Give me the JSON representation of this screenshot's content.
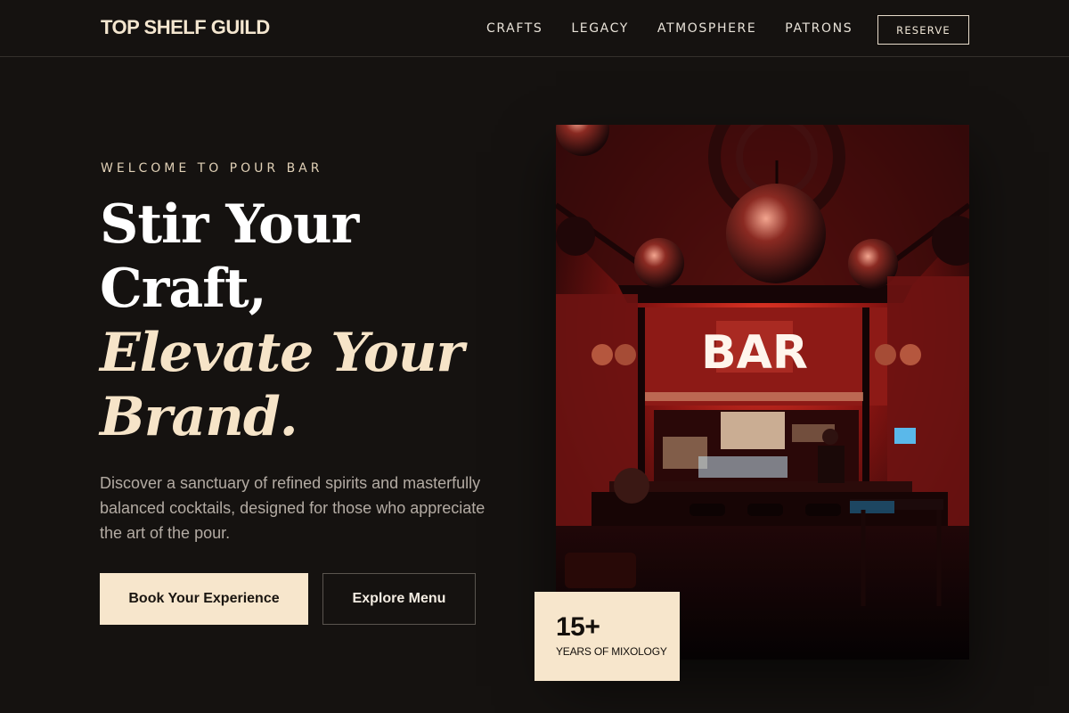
{
  "header": {
    "logo": "TOP SHELF GUILD",
    "nav": [
      "CRAFTS",
      "LEGACY",
      "ATMOSPHERE",
      "PATRONS"
    ],
    "reserve_label": "RESERVE"
  },
  "hero": {
    "eyebrow": "WELCOME TO POUR BAR",
    "headline_line1": "Stir Your",
    "headline_line2": "Craft,",
    "headline_accent_line1": "Elevate Your",
    "headline_accent_line2": "Brand.",
    "description": "Discover a sanctuary of refined spirits and masterfully balanced cocktails, designed for those who appreciate the art of the pour.",
    "primary_button": "Book Your Experience",
    "secondary_button": "Explore Menu"
  },
  "image": {
    "sign_text": "BAR",
    "description_icon": "bar-interior-photo"
  },
  "badge": {
    "number": "15+",
    "label": "YEARS OF MIXOLOGY"
  },
  "colors": {
    "background": "#151210",
    "accent_cream": "#f7e6cc",
    "bar_red": "#b3201e"
  }
}
